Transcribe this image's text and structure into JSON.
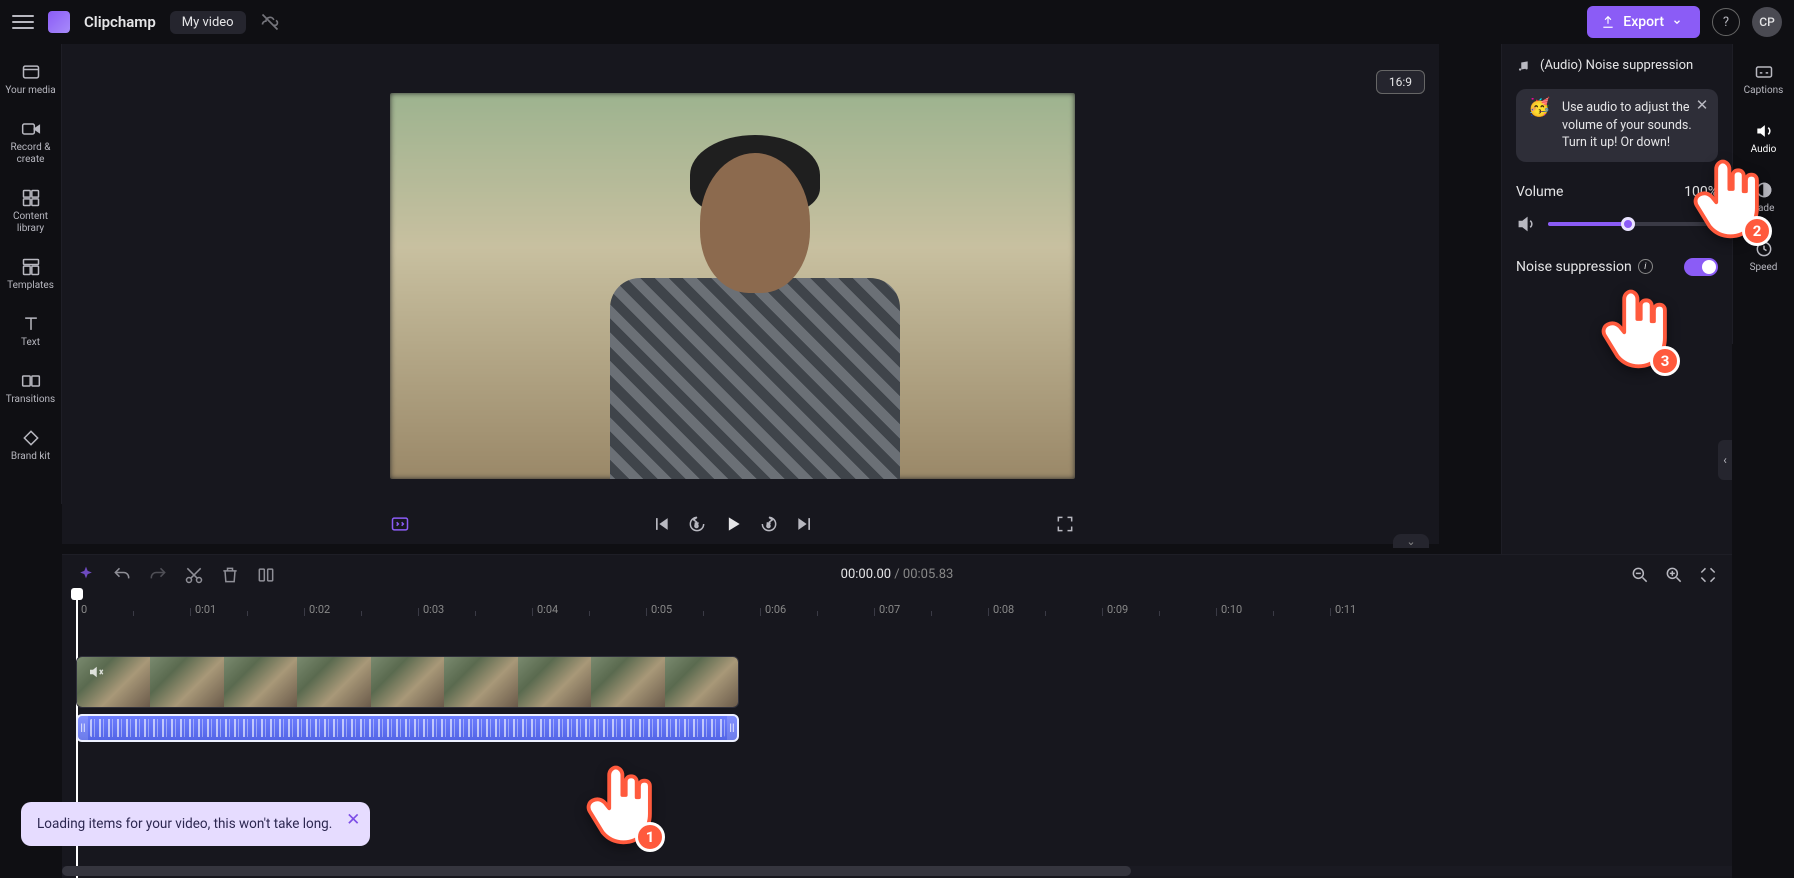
{
  "app": {
    "name": "Clipchamp",
    "video_title": "My video",
    "export": "Export",
    "avatar": "CP",
    "aspect": "16:9"
  },
  "left_rail": [
    {
      "label": "Your media"
    },
    {
      "label": "Record & create"
    },
    {
      "label": "Content library"
    },
    {
      "label": "Templates"
    },
    {
      "label": "Text"
    },
    {
      "label": "Transitions"
    },
    {
      "label": "Brand kit"
    }
  ],
  "right_rail": [
    {
      "label": "Captions"
    },
    {
      "label": "Audio"
    },
    {
      "label": "Fade"
    },
    {
      "label": "Speed"
    }
  ],
  "panel": {
    "header": "(Audio) Noise suppression",
    "tip": "Use audio to adjust the volume of your sounds. Turn it up! Or down!",
    "volume_label": "Volume",
    "volume_value": "100%",
    "noise_label": "Noise suppression"
  },
  "timeline": {
    "current": "00:00.00",
    "sep": " / ",
    "duration": "00:05.83",
    "ticks": [
      "0",
      "0:01",
      "0:02",
      "0:03",
      "0:04",
      "0:05",
      "0:06",
      "0:07",
      "0:08",
      "0:09",
      "0:10",
      "0:11"
    ]
  },
  "toast": "Loading items for your video, this won't take long.",
  "tutorial": {
    "p1": "1",
    "p2": "2",
    "p3": "3"
  }
}
